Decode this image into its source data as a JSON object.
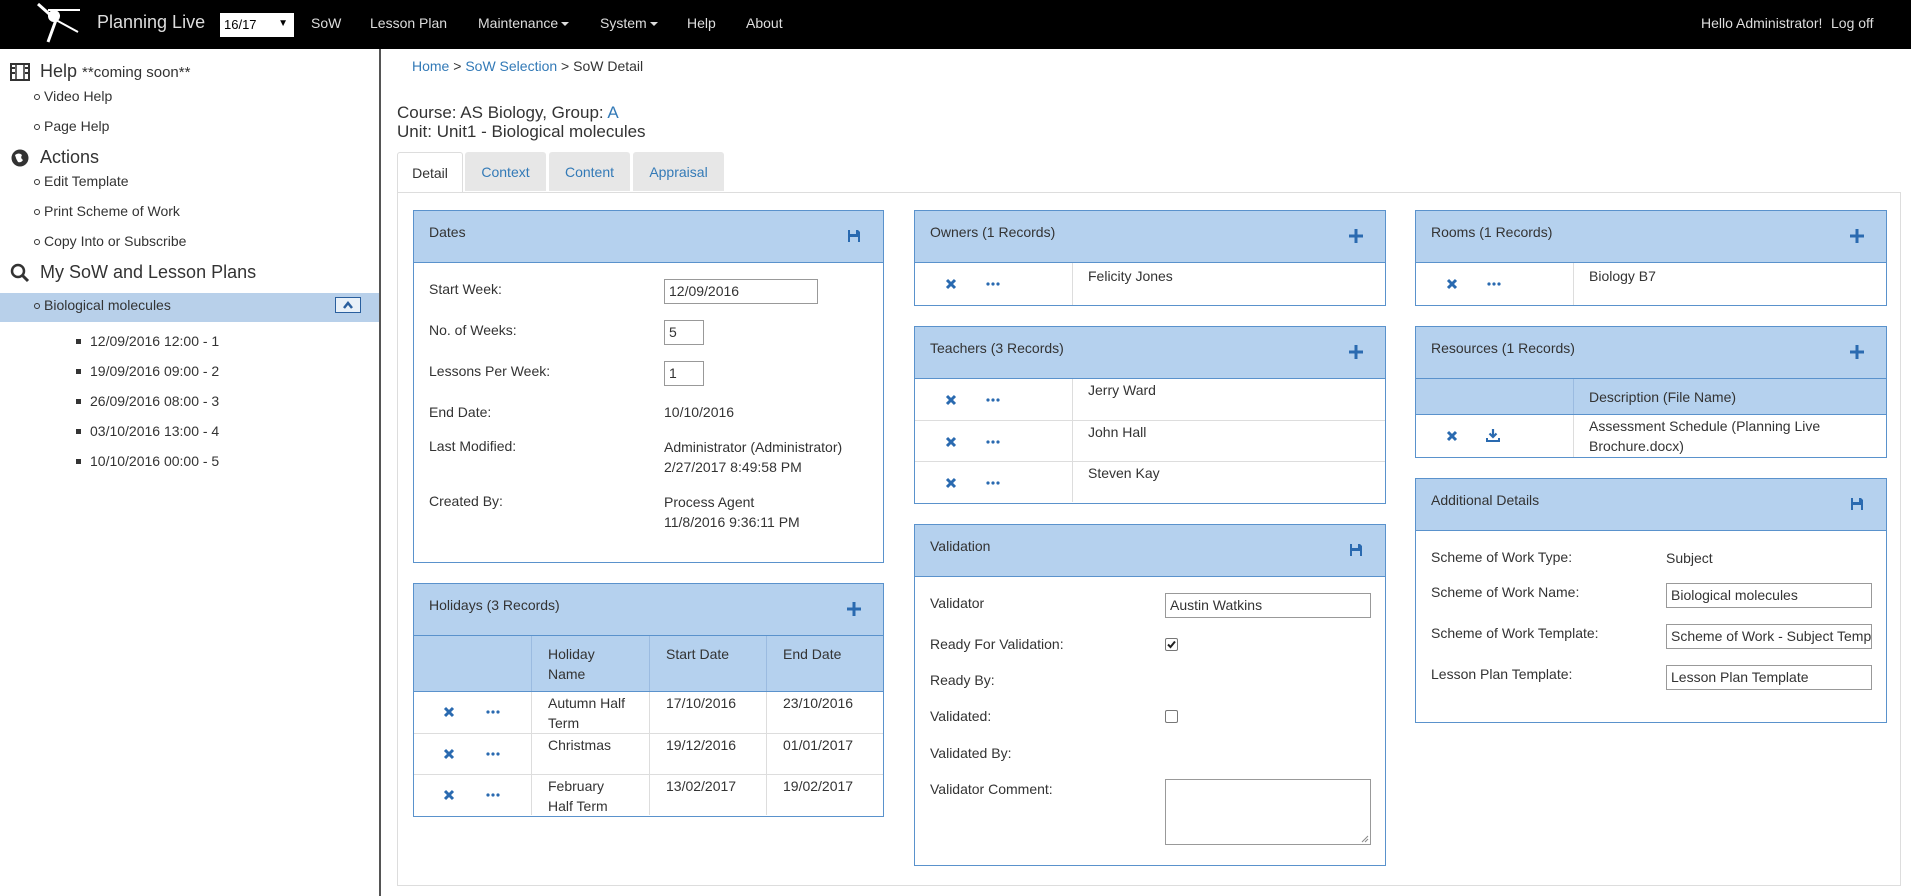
{
  "nav": {
    "brand": "Planning Live",
    "year": "16/17",
    "items": [
      "SoW",
      "Lesson Plan",
      "Maintenance",
      "System",
      "Help",
      "About"
    ],
    "greeting": "Hello Administrator!",
    "logoff": "Log off"
  },
  "sidebar": {
    "help": {
      "title": "Help",
      "note": "**coming soon**",
      "items": [
        "Video Help",
        "Page Help"
      ]
    },
    "actions": {
      "title": "Actions",
      "items": [
        "Edit Template",
        "Print Scheme of Work",
        "Copy Into or Subscribe"
      ]
    },
    "plans": {
      "title": "My SoW and Lesson Plans",
      "selected": "Biological molecules",
      "lessons": [
        "12/09/2016 12:00 - 1",
        "19/09/2016 09:00 - 2",
        "26/09/2016 08:00 - 3",
        "03/10/2016 13:00 - 4",
        "10/10/2016 00:00 - 5"
      ]
    }
  },
  "breadcrumb": {
    "home": "Home",
    "sep": ">",
    "selection": "SoW Selection",
    "current": "SoW Detail"
  },
  "header": {
    "course_label": "Course: AS Biology, Group:",
    "group": "A",
    "unit_label": "Unit:",
    "unit_code": "Unit1",
    "unit_sep": "-",
    "unit_name": "Biological molecules"
  },
  "tabs": [
    "Detail",
    "Context",
    "Content",
    "Appraisal"
  ],
  "dates": {
    "title": "Dates",
    "start_week_label": "Start Week:",
    "start_week": "12/09/2016",
    "weeks_label": "No. of Weeks:",
    "weeks": "5",
    "lpw_label": "Lessons Per Week:",
    "lpw": "1",
    "end_label": "End Date:",
    "end": "10/10/2016",
    "modified_label": "Last Modified:",
    "modified_by": "Administrator (Administrator)",
    "modified_at": "2/27/2017 8:49:58 PM",
    "created_label": "Created By:",
    "created_by": "Process Agent",
    "created_at": "11/8/2016 9:36:11 PM"
  },
  "holidays": {
    "title": "Holidays (3 Records)",
    "cols": [
      "Holiday",
      "Name",
      "Start Date",
      "End Date"
    ],
    "rows": [
      {
        "name1": "Autumn Half",
        "name2": "Term",
        "start": "17/10/2016",
        "end": "23/10/2016"
      },
      {
        "name1": "Christmas",
        "name2": "",
        "start": "19/12/2016",
        "end": "01/01/2017"
      },
      {
        "name1": "February",
        "name2": "Half Term",
        "start": "13/02/2017",
        "end": "19/02/2017"
      }
    ]
  },
  "owners": {
    "title": "Owners (1 Records)",
    "rows": [
      "Felicity Jones"
    ]
  },
  "teachers": {
    "title": "Teachers (3 Records)",
    "rows": [
      "Jerry Ward",
      "John Hall",
      "Steven Kay"
    ]
  },
  "validation": {
    "title": "Validation",
    "validator_label": "Validator",
    "validator": "Austin Watkins",
    "ready_label": "Ready For Validation:",
    "ready": true,
    "ready_by_label": "Ready By:",
    "validated_label": "Validated:",
    "validated": false,
    "validated_by_label": "Validated By:",
    "comment_label": "Validator Comment:"
  },
  "rooms": {
    "title": "Rooms (1 Records)",
    "rows": [
      "Biology B7"
    ]
  },
  "resources": {
    "title": "Resources (1 Records)",
    "col": "Description (File Name)",
    "row1": "Assessment Schedule (Planning Live",
    "row2": "Brochure.docx)"
  },
  "additional": {
    "title": "Additional Details",
    "type_label": "Scheme of Work Type:",
    "type": "Subject",
    "name_label": "Scheme of Work Name:",
    "name": "Biological molecules",
    "template_label": "Scheme of Work Template:",
    "template": "Scheme of Work - Subject Temp",
    "lp_label": "Lesson Plan Template:",
    "lp": "Lesson Plan Template"
  },
  "colors": {
    "navbar": "#000000",
    "panel_head": "#b5d1ee",
    "panel_border": "#5a92cc",
    "link": "#337ab7",
    "icon": "#2a6ab0",
    "selected": "#b8d0ea"
  }
}
